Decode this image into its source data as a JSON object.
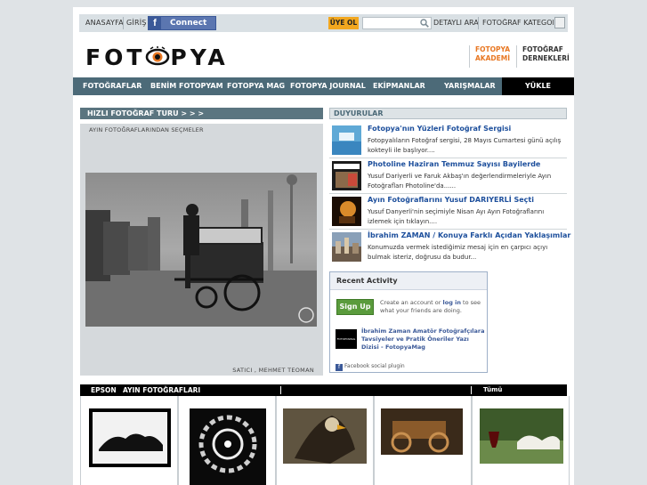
{
  "topbar": {
    "anasayfa": "ANASAYFA",
    "giris": "GİRİŞ",
    "connect": "Connect",
    "uye_ol": "ÜYE OL",
    "search_placeholder": "",
    "detayli_ara": "DETAYLI ARA",
    "kategori": "FOTOĞRAF KATEGORİ"
  },
  "logo": {
    "left": "FOT",
    "right": "PYA"
  },
  "header_links": [
    {
      "line1": "FOTOPYA",
      "line2": "AKADEMİ",
      "color": "#e87722"
    },
    {
      "line1": "FOTOĞRAF",
      "line2": "DERNEKLERİ",
      "color": "#333333"
    }
  ],
  "nav": {
    "items": [
      "FOTOĞRAFLAR",
      "BENİM FOTOPYAM",
      "FOTOPYA MAG",
      "FOTOPYA JOURNAL",
      "EKİPMANLAR",
      "YARIŞMALAR"
    ],
    "upload": "YÜKLE"
  },
  "photo_tour": {
    "title": "HIZLI FOTOĞRAF TURU > > >",
    "subtitle": "AYIN FOTOĞRAFLARINDAN SEÇMELER",
    "credit": "SATICI , MEHMET TEOMAN"
  },
  "announcements": {
    "title": "DUYURULAR",
    "items": [
      {
        "title": "Fotopya'nın Yüzleri Fotoğraf Sergisi",
        "desc": "Fotopyalıların Fotoğraf sergisi, 28 Mayıs Cumartesi günü açılış kokteyli ile başlıyor....",
        "thumb": "exhibition"
      },
      {
        "title": "Photoline Haziran Temmuz Sayısı Bayilerde",
        "desc": "Yusuf Dariyerli ve Faruk Akbaş'ın değerlendirmeleriyle Ayın Fotoğrafları Photoline'da......",
        "thumb": "magazine"
      },
      {
        "title": "Ayın Fotoğraflarını Yusuf DARIYERLİ Seçti",
        "desc": "Yusuf Danyerli'nin seçimiyle Nisan Ayı Ayın Fotoğraflarını izlemek için tıklayın....",
        "thumb": "orange"
      },
      {
        "title": "İbrahim ZAMAN / Konuya Farklı Açıdan Yaklaşımlar",
        "desc": "Konumuzda vermek istediğimiz mesaj için en çarpıcı açıyı bulmak isteriz, doğrusu da budur...",
        "thumb": "city"
      }
    ]
  },
  "recent_activity": {
    "title": "Recent Activity",
    "signup": "Sign Up",
    "text_pre": "Create an account or ",
    "login": "log in",
    "text_post": " to see what your friends are doing.",
    "story": "İbrahim Zaman Amatör Fotoğrafçılara Tavsiyeler ve Pratik Öneriler Yazı Dizisi - FotopyaMag",
    "thumb_text": "FOTOPYAMAG",
    "plugin": "Facebook social plugin"
  },
  "epson": {
    "brand": "EPSON",
    "label": "AYIN FOTOĞRAFLARI",
    "all": "Tümü"
  },
  "thumbs": [
    {
      "name": "bw-figures"
    },
    {
      "name": "bw-spiral"
    },
    {
      "name": "eagle"
    },
    {
      "name": "sepia-carriage"
    },
    {
      "name": "wine-book"
    }
  ],
  "colors": {
    "nav": "#4c6a78",
    "accent": "#f2a71f",
    "link": "#1d4f9c",
    "facebook": "#3b5998"
  }
}
